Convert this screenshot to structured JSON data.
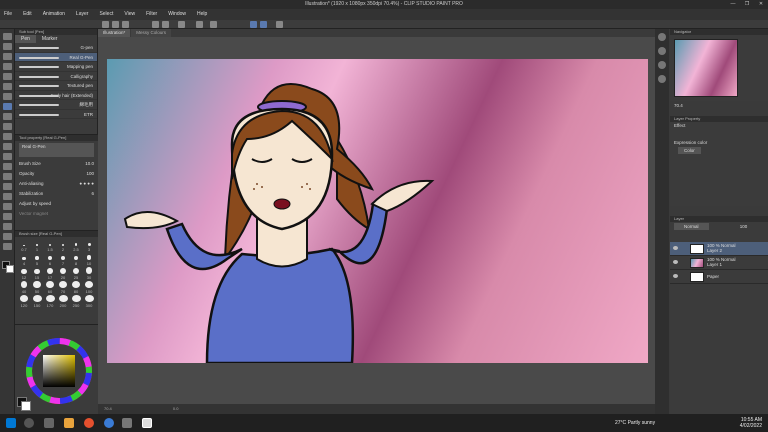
{
  "window": {
    "title": "Illustration* (1920 x 1080px 350dpi 70.4%) - CLIP STUDIO PAINT PRO",
    "controls": [
      "—",
      "❐",
      "✕"
    ]
  },
  "menu": [
    "File",
    "Edit",
    "Animation",
    "Layer",
    "Select",
    "View",
    "Filter",
    "Window",
    "Help"
  ],
  "subtool": {
    "header": "Sub tool [Pen]",
    "tabs": [
      "Pen",
      "Marker"
    ],
    "brushes": [
      "G-pen",
      "Real G-Pen",
      "Mapping pen",
      "Calligraphy",
      "Textured pen",
      "Curly hair (Extended)",
      "綿毛用",
      "ETR"
    ],
    "selected_index": 1
  },
  "tool_property": {
    "header": "Tool property [Real G-Pen]",
    "current": "Real G-Pen",
    "rows": [
      {
        "label": "Brush Size",
        "value": "10.0"
      },
      {
        "label": "Opacity",
        "value": "100"
      },
      {
        "label": "Anti-aliasing",
        "value": ""
      },
      {
        "label": "Stabilization",
        "value": "6"
      },
      {
        "label": "Adjust by speed",
        "value": ""
      },
      {
        "label": "Vector magnet",
        "value": ""
      }
    ]
  },
  "brush_size": {
    "header": "Brush size [Real G-Pen]",
    "sizes": [
      "0.7",
      "1",
      "1.5",
      "2",
      "2.5",
      "3",
      "4",
      "5",
      "6",
      "7",
      "8",
      "10",
      "12",
      "15",
      "17",
      "20",
      "25",
      "30",
      "40",
      "50",
      "60",
      "70",
      "80",
      "100",
      "120",
      "150",
      "170",
      "200",
      "250",
      "300"
    ]
  },
  "doc_tabs": [
    "Illustration*",
    "Messy Colours"
  ],
  "status_bar": {
    "zoom": "70.4",
    "angle": "0.0"
  },
  "navigator": {
    "header": "Navigator",
    "zoom": "70.4",
    "angle": "0.0"
  },
  "layer_property": {
    "header": "Layer Property",
    "effect_label": "Effect",
    "expression_label": "Expression color",
    "expression_value": "Color"
  },
  "layers": {
    "header": "Layer",
    "blend_mode": "Normal",
    "opacity": "100",
    "items": [
      {
        "percent": "100 % Normal",
        "name": "Layer 2"
      },
      {
        "percent": "100 % Normal",
        "name": "Layer 1"
      },
      {
        "percent": "",
        "name": "Paper"
      }
    ],
    "selected_index": 0
  },
  "taskbar": {
    "weather_temp": "27°C",
    "weather_text": "Partly sunny",
    "time": "10:55 AM",
    "date": "4/02/2022"
  },
  "colors": {
    "main": "#111111",
    "sub": "#ffffff",
    "canvas_accent": "#a04a7a"
  }
}
